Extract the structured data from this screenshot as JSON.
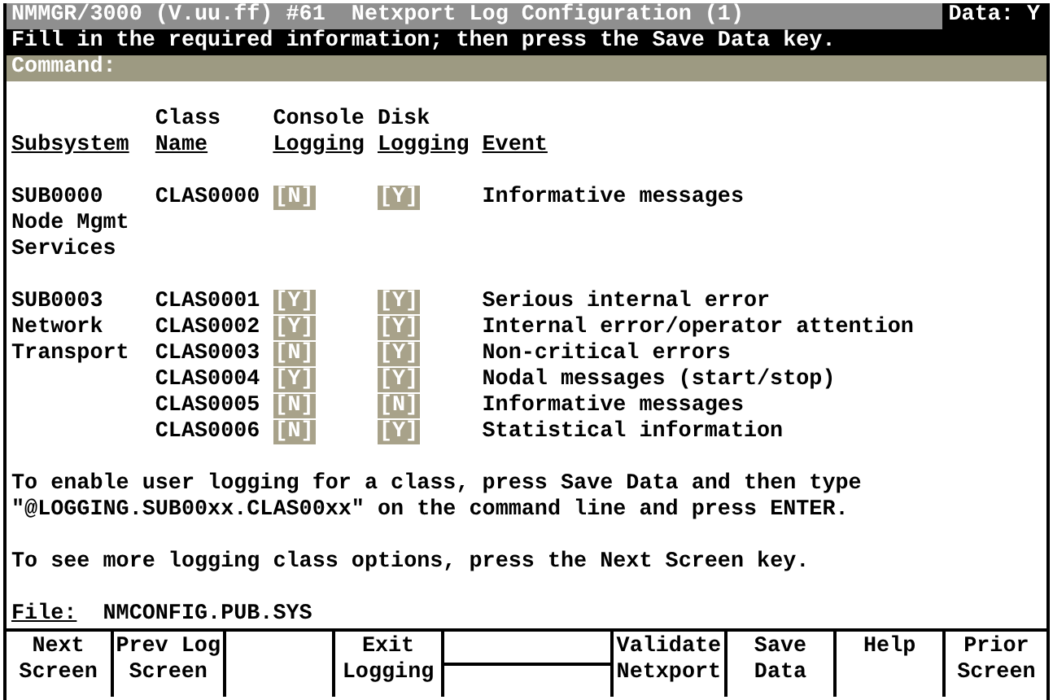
{
  "title_bar": {
    "title": "NMMGR/3000 (V.uu.ff) #61  Netxport Log Configuration (1)",
    "data_flag": "Data: Y"
  },
  "message": "Fill in the required information; then press the Save Data key.",
  "command": {
    "label": "Command:"
  },
  "columns": [
    [
      "Subsystem"
    ],
    [
      "Class",
      "Name"
    ],
    [
      "Console",
      "Logging"
    ],
    [
      "Disk",
      "Logging"
    ],
    [
      "Event"
    ]
  ],
  "groups": [
    {
      "subsystem": [
        "SUB0000",
        "Node Mgmt",
        "Services"
      ],
      "classes": [
        {
          "name": "CLAS0000",
          "console": "[N]",
          "disk": "[Y]",
          "event": "Informative messages"
        }
      ]
    },
    {
      "subsystem": [
        "SUB0003",
        "Network",
        "Transport"
      ],
      "classes": [
        {
          "name": "CLAS0001",
          "console": "[Y]",
          "disk": "[Y]",
          "event": "Serious internal error"
        },
        {
          "name": "CLAS0002",
          "console": "[Y]",
          "disk": "[Y]",
          "event": "Internal error/operator attention"
        },
        {
          "name": "CLAS0003",
          "console": "[N]",
          "disk": "[Y]",
          "event": "Non-critical errors"
        },
        {
          "name": "CLAS0004",
          "console": "[Y]",
          "disk": "[Y]",
          "event": "Nodal messages (start/stop)"
        },
        {
          "name": "CLAS0005",
          "console": "[N]",
          "disk": "[N]",
          "event": "Informative messages"
        },
        {
          "name": "CLAS0006",
          "console": "[N]",
          "disk": "[Y]",
          "event": "Statistical information"
        }
      ]
    }
  ],
  "notes": [
    [
      "To enable user logging for a class, press Save Data and then type",
      "\"@LOGGING.SUB00xx.CLAS00xx\" on the command line and press ENTER."
    ],
    [
      "To see more logging class options, press the Next Screen key."
    ]
  ],
  "file": {
    "label": "File:",
    "value": "NMCONFIG.PUB.SYS"
  },
  "function_keys": [
    {
      "kind": "label",
      "lines": [
        "Next",
        "Screen"
      ]
    },
    {
      "kind": "label",
      "lines": [
        "Prev Log",
        "Screen"
      ]
    },
    {
      "kind": "blank"
    },
    {
      "kind": "label",
      "lines": [
        "Exit",
        "Logging"
      ]
    },
    {
      "kind": "split"
    },
    {
      "kind": "label",
      "lines": [
        "Validate",
        "Netxport"
      ]
    },
    {
      "kind": "label",
      "lines": [
        "Save",
        "Data"
      ]
    },
    {
      "kind": "label",
      "lines": [
        "Help"
      ]
    },
    {
      "kind": "label",
      "lines": [
        "Prior",
        "Screen"
      ]
    }
  ]
}
